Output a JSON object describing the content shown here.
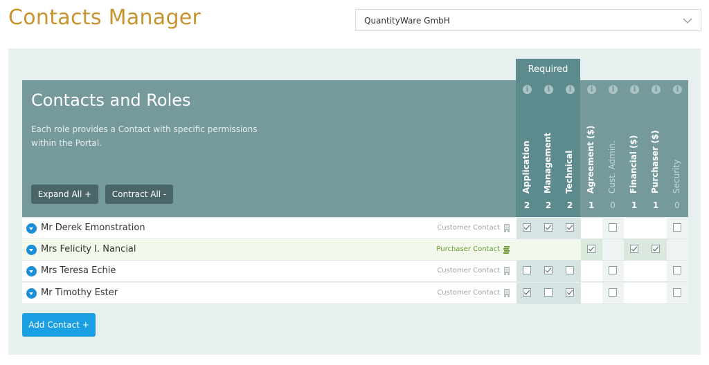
{
  "app_title": "Contacts Manager",
  "company_select": {
    "value": "QuantityWare GmbH"
  },
  "required_label": "Required",
  "panel": {
    "title": "Contacts and Roles",
    "description": "Each role provides a Contact with specific permissions within the Portal.",
    "expand_label": "Expand All +",
    "contract_label": "Contract All -"
  },
  "columns": [
    {
      "label": "Application",
      "count": "2"
    },
    {
      "label": "Management",
      "count": "2"
    },
    {
      "label": "Technical",
      "count": "2"
    },
    {
      "label": "Agreement ($)",
      "count": "1"
    },
    {
      "label": "Cust. Admin.",
      "count": "0"
    },
    {
      "label": "Financial ($)",
      "count": "1"
    },
    {
      "label": "Purchaser ($)",
      "count": "1"
    },
    {
      "label": "Security",
      "count": "0"
    }
  ],
  "contacts": [
    {
      "name": "Mr Derek Emonstration",
      "type": "Customer Contact",
      "roles": [
        true,
        true,
        true,
        null,
        false,
        null,
        null,
        false
      ]
    },
    {
      "name": "Mrs Felicity I. Nancial",
      "type": "Purchaser Contact",
      "roles": [
        null,
        null,
        null,
        true,
        null,
        true,
        true,
        null
      ]
    },
    {
      "name": "Mrs Teresa Echie",
      "type": "Customer Contact",
      "roles": [
        false,
        true,
        false,
        null,
        false,
        null,
        null,
        false
      ]
    },
    {
      "name": "Mr Timothy Ester",
      "type": "Customer Contact",
      "roles": [
        true,
        false,
        true,
        null,
        false,
        null,
        null,
        false
      ]
    }
  ],
  "add_contact_label": "Add Contact +",
  "colors": {
    "title": "#c8932e",
    "panel": "#769a9c",
    "required": "#5d8a8c",
    "primary_button": "#1a9fe2"
  }
}
